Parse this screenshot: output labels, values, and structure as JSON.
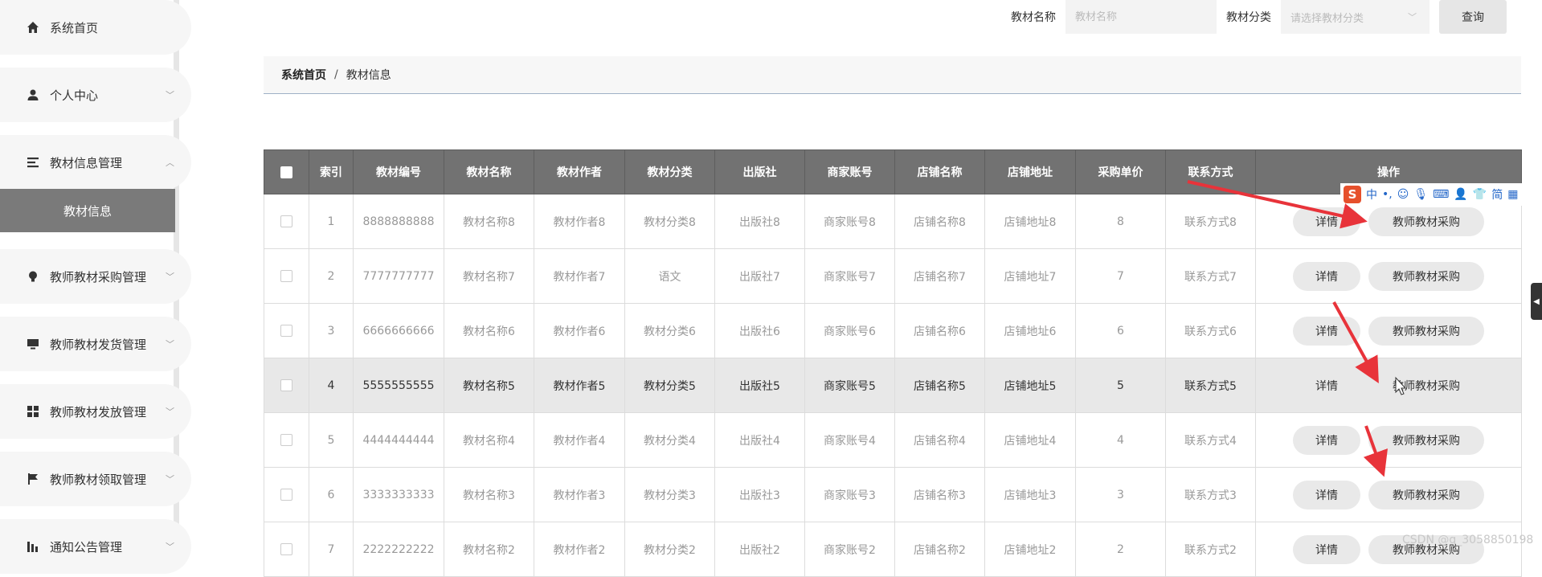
{
  "sidebar": {
    "items": [
      {
        "label": "系统首页",
        "icon": "home-icon"
      },
      {
        "label": "个人中心",
        "icon": "person-icon",
        "chevron": "down"
      },
      {
        "label": "教材信息管理",
        "icon": "list-icon",
        "chevron": "up"
      },
      {
        "label": "教师教材采购管理",
        "icon": "bulb-icon",
        "chevron": "down"
      },
      {
        "label": "教师教材发货管理",
        "icon": "monitor-icon",
        "chevron": "down"
      },
      {
        "label": "教师教材发放管理",
        "icon": "grid-icon",
        "chevron": "down"
      },
      {
        "label": "教师教材领取管理",
        "icon": "flag-icon",
        "chevron": "down"
      },
      {
        "label": "通知公告管理",
        "icon": "chart-icon",
        "chevron": "down"
      }
    ],
    "active_sub": "教材信息"
  },
  "search": {
    "name_label": "教材名称",
    "name_placeholder": "教材名称",
    "category_label": "教材分类",
    "category_placeholder": "请选择教材分类",
    "query_button": "查询"
  },
  "breadcrumb": {
    "home": "系统首页",
    "separator": "/",
    "current": "教材信息"
  },
  "table": {
    "headers": [
      "索引",
      "教材编号",
      "教材名称",
      "教材作者",
      "教材分类",
      "出版社",
      "商家账号",
      "店铺名称",
      "店铺地址",
      "采购单价",
      "联系方式",
      "操作"
    ],
    "rows": [
      [
        "1",
        "8888888888",
        "教材名称8",
        "教材作者8",
        "教材分类8",
        "出版社8",
        "商家账号8",
        "店铺名称8",
        "店铺地址8",
        "8",
        "联系方式8"
      ],
      [
        "2",
        "7777777777",
        "教材名称7",
        "教材作者7",
        "语文",
        "出版社7",
        "商家账号7",
        "店铺名称7",
        "店铺地址7",
        "7",
        "联系方式7"
      ],
      [
        "3",
        "6666666666",
        "教材名称6",
        "教材作者6",
        "教材分类6",
        "出版社6",
        "商家账号6",
        "店铺名称6",
        "店铺地址6",
        "6",
        "联系方式6"
      ],
      [
        "4",
        "5555555555",
        "教材名称5",
        "教材作者5",
        "教材分类5",
        "出版社5",
        "商家账号5",
        "店铺名称5",
        "店铺地址5",
        "5",
        "联系方式5"
      ],
      [
        "5",
        "4444444444",
        "教材名称4",
        "教材作者4",
        "教材分类4",
        "出版社4",
        "商家账号4",
        "店铺名称4",
        "店铺地址4",
        "4",
        "联系方式4"
      ],
      [
        "6",
        "3333333333",
        "教材名称3",
        "教材作者3",
        "教材分类3",
        "出版社3",
        "商家账号3",
        "店铺名称3",
        "店铺地址3",
        "3",
        "联系方式3"
      ],
      [
        "7",
        "2222222222",
        "教材名称2",
        "教材作者2",
        "教材分类2",
        "出版社2",
        "商家账号2",
        "店铺名称2",
        "店铺地址2",
        "2",
        "联系方式2"
      ]
    ],
    "highlighted_row": 3,
    "detail_button": "详情",
    "buy_button": "教师教材采购"
  },
  "ime": {
    "logo": "S",
    "mode": "中",
    "simplified": "简"
  },
  "watermark": "CSDN @q_3058850198",
  "colors": {
    "header_bg": "#727272",
    "sidebar_active": "#7a7a7a",
    "arrow": "#e8333a",
    "ime_logo": "#e6502c"
  }
}
